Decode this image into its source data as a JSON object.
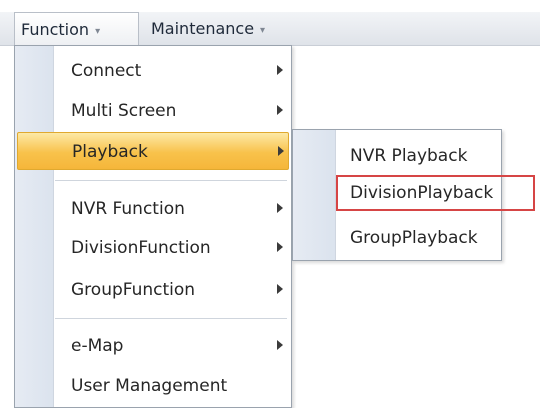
{
  "menubar": {
    "function_label": "Function",
    "maintenance_label": "Maintenance",
    "dropdown_arrow": "▾"
  },
  "menu": {
    "items": [
      {
        "label": "Connect",
        "has_submenu": true
      },
      {
        "label": "Multi Screen",
        "has_submenu": true
      },
      {
        "label": "Playback",
        "has_submenu": true,
        "highlighted": true
      },
      {
        "label": "NVR Function",
        "has_submenu": true
      },
      {
        "label": "DivisionFunction",
        "has_submenu": true
      },
      {
        "label": "GroupFunction",
        "has_submenu": true
      },
      {
        "label": "e-Map",
        "has_submenu": true
      },
      {
        "label": "User Management",
        "has_submenu": false
      }
    ]
  },
  "submenu": {
    "items": [
      {
        "label": "NVR Playback"
      },
      {
        "label": "DivisionPlayback",
        "selected": true
      },
      {
        "label": "GroupPlayback"
      }
    ]
  },
  "colors": {
    "highlight": "#f8c24b",
    "selection_border": "#d64545",
    "gutter": "#dbe3ee"
  }
}
